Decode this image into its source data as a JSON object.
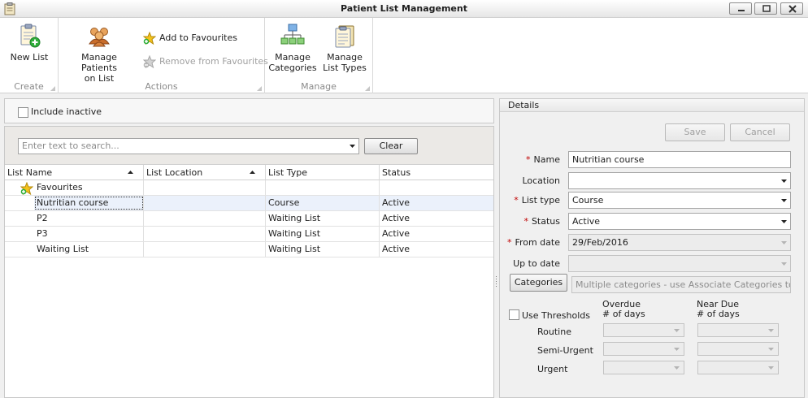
{
  "window": {
    "title": "Patient List Management"
  },
  "ribbon": {
    "groups": [
      {
        "label": "Create"
      },
      {
        "label": "Actions"
      },
      {
        "label": "Manage"
      }
    ],
    "new_list": "New List",
    "manage_patients_line1": "Manage Patients",
    "manage_patients_line2": "on List",
    "add_favourites": "Add to Favourites",
    "remove_favourites": "Remove from Favourites",
    "manage_categories_line1": "Manage",
    "manage_categories_line2": "Categories",
    "manage_list_types_line1": "Manage",
    "manage_list_types_line2": "List Types"
  },
  "filter": {
    "include_inactive_label": "Include inactive",
    "include_inactive_checked": false
  },
  "search": {
    "placeholder": "Enter text to search...",
    "clear_label": "Clear"
  },
  "grid": {
    "columns": [
      "List Name",
      "List Location",
      "List Type",
      "Status"
    ],
    "group_label": "Favourites",
    "rows": [
      {
        "name": "Nutritian course",
        "location": "",
        "type": "Course",
        "status": "Active",
        "selected": true
      },
      {
        "name": "P2",
        "location": "",
        "type": "Waiting List",
        "status": "Active"
      },
      {
        "name": "P3",
        "location": "",
        "type": "Waiting List",
        "status": "Active"
      },
      {
        "name": "Waiting List",
        "location": "",
        "type": "Waiting List",
        "status": "Active"
      }
    ]
  },
  "details": {
    "title": "Details",
    "save_label": "Save",
    "cancel_label": "Cancel",
    "required_marker": "*",
    "name_label": "Name",
    "name_value": "Nutritian course",
    "location_label": "Location",
    "location_value": "",
    "list_type_label": "List type",
    "list_type_value": "Course",
    "status_label": "Status",
    "status_value": "Active",
    "from_date_label": "From date",
    "from_date_value": "29/Feb/2016",
    "up_to_date_label": "Up to date",
    "up_to_date_value": "",
    "categories_button": "Categories",
    "categories_value": "Multiple categories - use Associate Categories to vie...",
    "thresholds": {
      "use_label": "Use Thresholds",
      "checked": false,
      "overdue_line1": "Overdue",
      "overdue_line2": "# of days",
      "neardue_line1": "Near Due",
      "neardue_line2": "# of days",
      "rows": [
        "Routine",
        "Semi-Urgent",
        "Urgent"
      ]
    }
  },
  "colors": {
    "required": "#c00000",
    "selection": "#ebf1fb",
    "favourite_star": "#f3c21b"
  }
}
